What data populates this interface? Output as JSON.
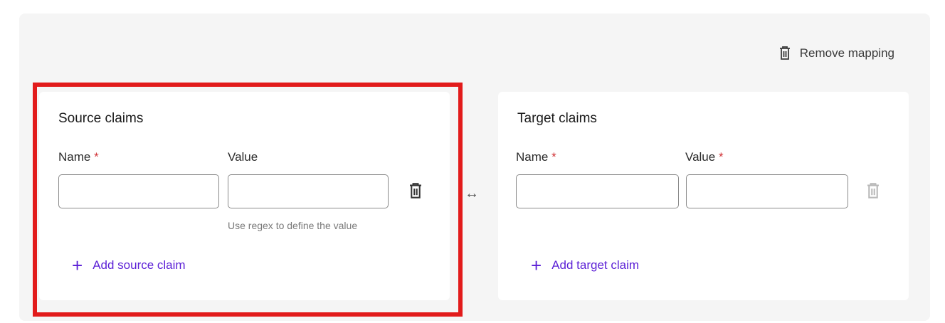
{
  "remove_mapping": {
    "label": "Remove mapping",
    "icon": "trash-icon"
  },
  "source": {
    "title": "Source claims",
    "name_label": "Name",
    "value_label": "Value",
    "required_mark": "*",
    "name_value": "",
    "value_value": "",
    "value_help": "Use regex to define the value",
    "add_label": "Add source claim",
    "add_icon": "plus-icon"
  },
  "target": {
    "title": "Target claims",
    "name_label": "Name",
    "value_label": "Value",
    "required_mark": "*",
    "name_value": "",
    "value_value": "",
    "add_label": "Add target claim",
    "add_icon": "plus-icon"
  },
  "mapping_arrow": "↔",
  "colors": {
    "panel": "#f5f5f5",
    "accent": "#5b1fd6",
    "required": "#d13438",
    "highlight": "#e21b1b"
  }
}
